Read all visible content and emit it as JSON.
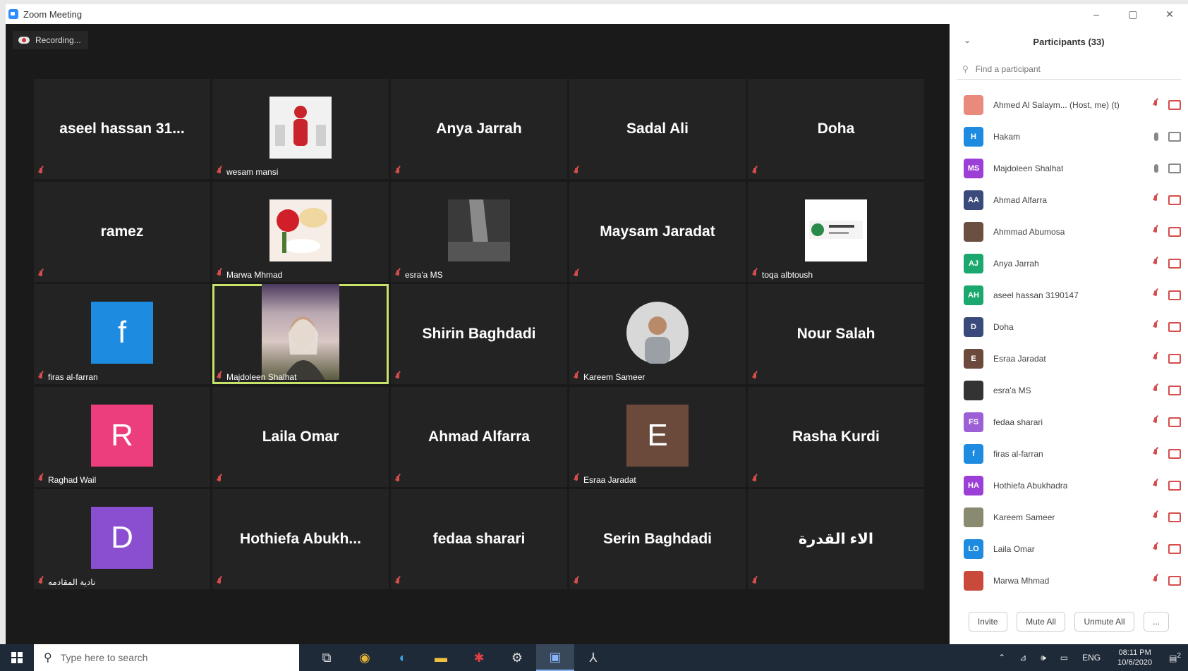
{
  "window": {
    "title": "Zoom Meeting",
    "controls": [
      "–",
      "▢",
      "✕"
    ]
  },
  "recording": {
    "label": "Recording..."
  },
  "tiles": [
    {
      "type": "name",
      "name": "aseel  hassan  31..."
    },
    {
      "type": "image",
      "img": "red-figure",
      "caption": "wesam mansi"
    },
    {
      "type": "name",
      "name": "Anya Jarrah"
    },
    {
      "type": "name",
      "name": "Sadal Ali"
    },
    {
      "type": "name",
      "name": "Doha"
    },
    {
      "type": "name",
      "name": "ramez"
    },
    {
      "type": "image",
      "img": "roses",
      "caption": "Marwa Mhmad"
    },
    {
      "type": "image",
      "img": "dark-photo",
      "caption": "esra'a MS"
    },
    {
      "type": "name",
      "name": "Maysam Jaradat"
    },
    {
      "type": "image",
      "img": "card",
      "caption": "toqa albtoush"
    },
    {
      "type": "letter",
      "letter": "f",
      "color": "#1d8ce0",
      "caption": "firas al-farran"
    },
    {
      "type": "video",
      "caption": "Majdoleen Shalhat",
      "active": true
    },
    {
      "type": "name",
      "name": "Shirin Baghdadi"
    },
    {
      "type": "image",
      "img": "man-portrait",
      "caption": "Kareem Sameer"
    },
    {
      "type": "name",
      "name": "Nour Salah"
    },
    {
      "type": "letter",
      "letter": "R",
      "color": "#ec3d7c",
      "caption": "Raghad Wail"
    },
    {
      "type": "name",
      "name": "Laila Omar"
    },
    {
      "type": "name",
      "name": "Ahmad Alfarra"
    },
    {
      "type": "letter",
      "letter": "E",
      "color": "#6b4a3c",
      "caption": "Esraa Jaradat"
    },
    {
      "type": "name",
      "name": "Rasha Kurdi"
    },
    {
      "type": "letter",
      "letter": "D",
      "color": "#8a4fd1",
      "caption": "نادية المقادمه"
    },
    {
      "type": "name",
      "name": "Hothiefa  Abukh..."
    },
    {
      "type": "name",
      "name": "fedaa sharari"
    },
    {
      "type": "name",
      "name": "Serin Baghdadi"
    },
    {
      "type": "name",
      "name": "الاء القدرة"
    }
  ],
  "panel": {
    "title": "Participants (33)",
    "search_placeholder": "Find a participant",
    "participants": [
      {
        "initials": "",
        "color": "#e88a7c",
        "name": "Ahmed Al Salaym... (Host, me) (t)",
        "mic": "off",
        "cam": "off"
      },
      {
        "initials": "H",
        "color": "#1d8ce0",
        "name": "Hakam",
        "mic": "on",
        "cam": "on"
      },
      {
        "initials": "MS",
        "color": "#9c3fd6",
        "name": "Majdoleen Shalhat",
        "mic": "on",
        "cam": "on"
      },
      {
        "initials": "AA",
        "color": "#3a4a7a",
        "name": "Ahmad Alfarra",
        "mic": "off",
        "cam": "off"
      },
      {
        "initials": "",
        "color": "#6a5040",
        "name": "Ahmmad Abumosa",
        "mic": "off",
        "cam": "off"
      },
      {
        "initials": "AJ",
        "color": "#1aa86e",
        "name": "Anya Jarrah",
        "mic": "off",
        "cam": "off"
      },
      {
        "initials": "AH",
        "color": "#1aa86e",
        "name": "aseel hassan 3190147",
        "mic": "off",
        "cam": "off"
      },
      {
        "initials": "D",
        "color": "#3a4a7a",
        "name": "Doha",
        "mic": "off",
        "cam": "off"
      },
      {
        "initials": "E",
        "color": "#6b4a3c",
        "name": "Esraa Jaradat",
        "mic": "off",
        "cam": "off"
      },
      {
        "initials": "",
        "color": "#333333",
        "name": "esra'a MS",
        "mic": "off",
        "cam": "off"
      },
      {
        "initials": "FS",
        "color": "#9c5fd6",
        "name": "fedaa sharari",
        "mic": "off",
        "cam": "off"
      },
      {
        "initials": "f",
        "color": "#1d8ce0",
        "name": "firas al-farran",
        "mic": "off",
        "cam": "off"
      },
      {
        "initials": "HA",
        "color": "#9c3fd6",
        "name": "Hothiefa Abukhadra",
        "mic": "off",
        "cam": "off"
      },
      {
        "initials": "",
        "color": "#8a8a70",
        "name": "Kareem Sameer",
        "mic": "off",
        "cam": "off"
      },
      {
        "initials": "LO",
        "color": "#1d8ce0",
        "name": "Laila Omar",
        "mic": "off",
        "cam": "off"
      },
      {
        "initials": "",
        "color": "#c94a3a",
        "name": "Marwa Mhmad",
        "mic": "off",
        "cam": "off"
      }
    ],
    "footer": [
      "Invite",
      "Mute All",
      "Unmute All",
      "..."
    ]
  },
  "taskbar": {
    "search_placeholder": "Type here to search",
    "apps": [
      "task-view",
      "chrome",
      "edge",
      "explorer",
      "app-red",
      "settings",
      "zoom",
      "acrobat"
    ],
    "tray_lang": "ENG",
    "time": "08:11 PM",
    "date": "10/6/2020",
    "notif_count": "2"
  }
}
